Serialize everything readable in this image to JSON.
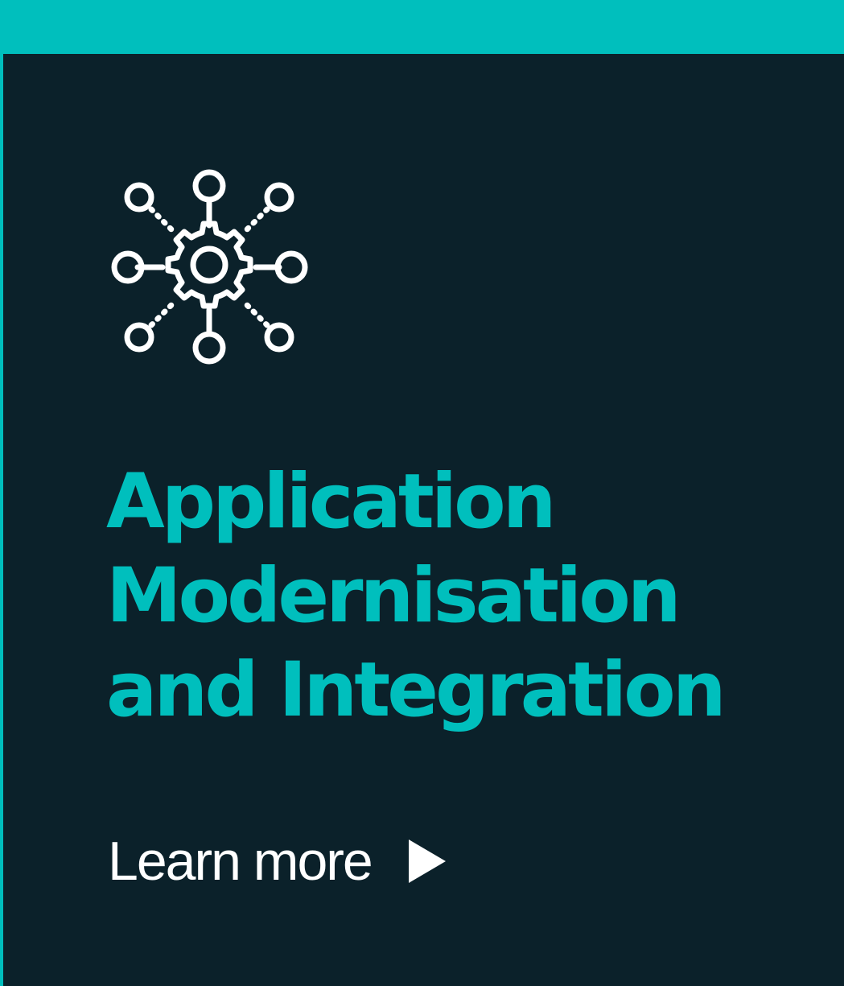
{
  "card": {
    "icon": "gear-network-icon",
    "title_lines": [
      "Application",
      "Modernisation",
      "and Integration"
    ],
    "cta_label": "Learn more",
    "cta_icon": "play-arrow-icon"
  },
  "colors": {
    "accent": "#00bfbd",
    "background": "#0b212a",
    "text": "#ffffff"
  }
}
